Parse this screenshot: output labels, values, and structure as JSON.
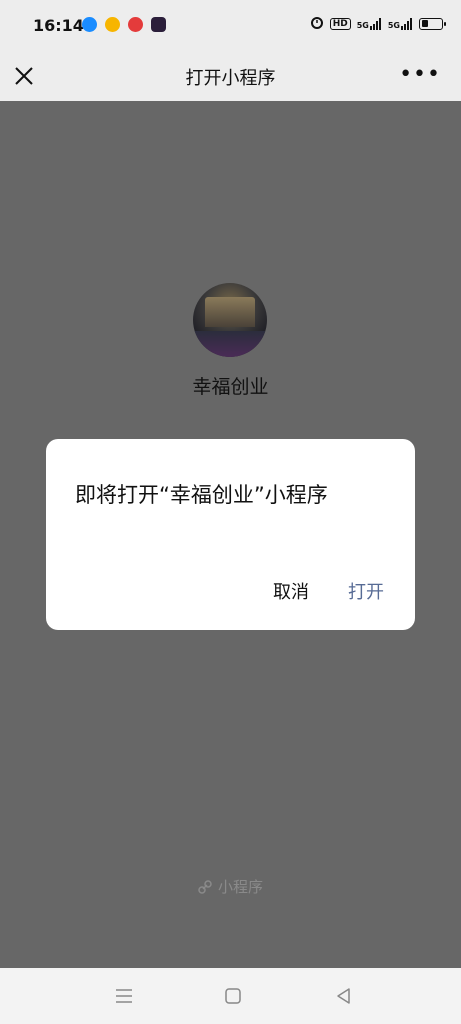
{
  "status": {
    "time": "16:14",
    "apps": [
      "browser",
      "weibo",
      "video",
      "tiktok"
    ],
    "signal_labels": [
      "HD",
      "5G",
      "5G"
    ],
    "battery_level": 0.35
  },
  "navbar": {
    "title": "打开小程序",
    "more": "•••"
  },
  "app": {
    "name": "幸福创业"
  },
  "dialog": {
    "message": "即将打开“幸福创业”小程序",
    "cancel_label": "取消",
    "open_label": "打开"
  },
  "footer": {
    "label": "小程序"
  },
  "colors": {
    "overlay": "#676767",
    "accent": "#576b95"
  }
}
